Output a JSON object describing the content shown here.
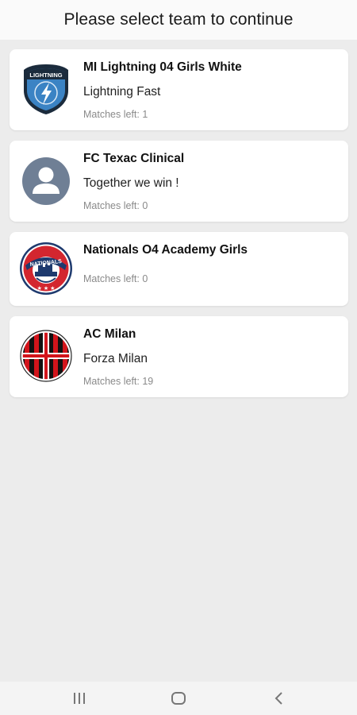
{
  "header": {
    "title": "Please select team to continue"
  },
  "teams": [
    {
      "name": "MI Lightning 04 Girls White",
      "motto": "Lightning Fast",
      "matches": "Matches left: 1",
      "logo_icon": "lightning-shield-logo-icon",
      "crest_text": "LIGHTNING"
    },
    {
      "name": "FC Texac Clinical",
      "motto": "Together we win !",
      "matches": "Matches left: 0",
      "logo_icon": "default-avatar-icon"
    },
    {
      "name": "Nationals O4 Academy Girls",
      "motto": "",
      "matches": "Matches left: 0",
      "logo_icon": "nationals-logo-icon",
      "crest_text": "NATIONALS"
    },
    {
      "name": "AC Milan",
      "motto": "Forza Milan",
      "matches": "Matches left: 19",
      "logo_icon": "ac-milan-crest-icon"
    }
  ],
  "navbar": {
    "recents_icon": "recents-icon",
    "home_icon": "home-icon",
    "back_icon": "back-icon"
  },
  "colors": {
    "lightning_blue": "#3b83c4",
    "nationals_red": "#d3262f",
    "nationals_navy": "#1e3a6e",
    "milan_red": "#d2141b",
    "avatar_gray": "#6f7f95"
  }
}
